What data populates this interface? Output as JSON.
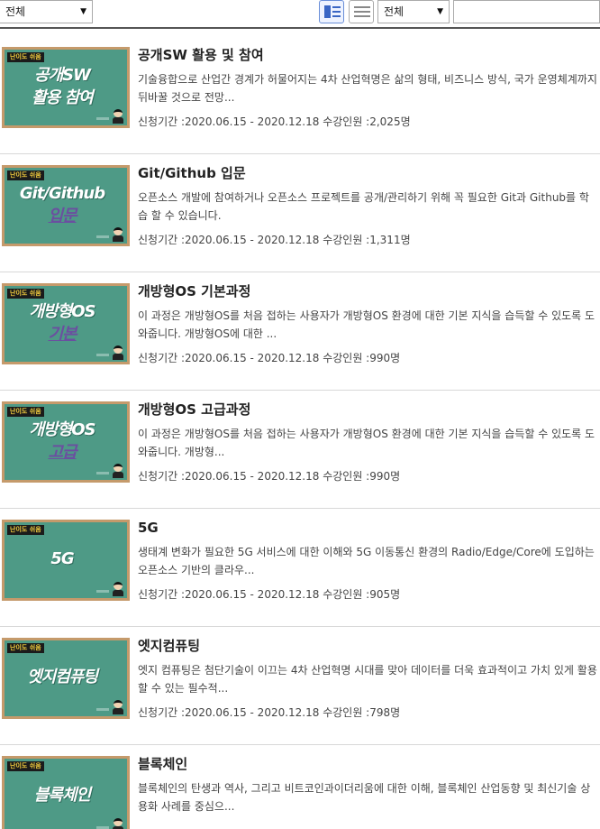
{
  "toolbar": {
    "filter_left": "전체",
    "filter_right": "전체",
    "search_value": ""
  },
  "courses": [
    {
      "title": "공개SW 활용 및 참여",
      "desc": "기술융합으로 산업간 경계가 허물어지는 4차 산업혁명은 삶의 형태, 비즈니스 방식, 국가 운영체계까지 뒤바꿀 것으로 전망...",
      "meta": "신청기간 :2020.06.15 - 2020.12.18 수강인원 :2,025명",
      "thumb_tag": "난이도 쉬움",
      "thumb_line1": "공개SW",
      "thumb_line2": "활용 참여"
    },
    {
      "title": "Git/Github 입문",
      "desc": "오픈소스 개발에 참여하거나 오픈소스 프로젝트를 공개/관리하기 위해 꼭 필요한 Git과 Github를 학습 할 수 있습니다.",
      "meta": "신청기간 :2020.06.15 - 2020.12.18 수강인원 :1,311명",
      "thumb_tag": "난이도 쉬움",
      "thumb_line1": "Git/Github",
      "thumb_line2": "입문"
    },
    {
      "title": "개방형OS 기본과정",
      "desc": "이 과정은 개방형OS를 처음 접하는 사용자가 개방형OS 환경에 대한 기본 지식을 습득할 수 있도록 도와줍니다. 개방형OS에 대한 ...",
      "meta": "신청기간 :2020.06.15 - 2020.12.18 수강인원 :990명",
      "thumb_tag": "난이도 쉬움",
      "thumb_line1": "개방형OS",
      "thumb_line2": "기본"
    },
    {
      "title": "개방형OS 고급과정",
      "desc": "이 과정은 개방형OS를 처음 접하는 사용자가 개방형OS 환경에 대한 기본 지식을 습득할 수 있도록 도와줍니다. 개방형...",
      "meta": "신청기간 :2020.06.15 - 2020.12.18 수강인원 :990명",
      "thumb_tag": "난이도 쉬움",
      "thumb_line1": "개방형OS",
      "thumb_line2": "고급"
    },
    {
      "title": "5G",
      "desc": " 생태계 변화가 필요한 5G 서비스에 대한 이해와 5G 이동통신 환경의 Radio/Edge/Core에 도입하는 오픈소스 기반의 클라우...",
      "meta": "신청기간 :2020.06.15 - 2020.12.18 수강인원 :905명",
      "thumb_tag": "난이도 쉬움",
      "thumb_line1": "5G",
      "thumb_line2": ""
    },
    {
      "title": "엣지컴퓨팅",
      "desc": " 엣지 컴퓨팅은 첨단기술이 이끄는 4차 산업혁명 시대를 맞아 데이터를 더욱 효과적이고 가치 있게 활용할 수 있는 필수적...",
      "meta": "신청기간 :2020.06.15 - 2020.12.18 수강인원 :798명",
      "thumb_tag": "난이도 쉬움",
      "thumb_line1": "엣지컴퓨팅",
      "thumb_line2": ""
    },
    {
      "title": "블록체인",
      "desc": " 블록체인의 탄생과 역사, 그리고 비트코인과이더리움에 대한 이해, 블록체인 산업동향 및 최신기술 상용화 사례를 중심으...",
      "meta": "",
      "thumb_tag": "난이도 쉬움",
      "thumb_line1": "블록체인",
      "thumb_line2": ""
    }
  ]
}
